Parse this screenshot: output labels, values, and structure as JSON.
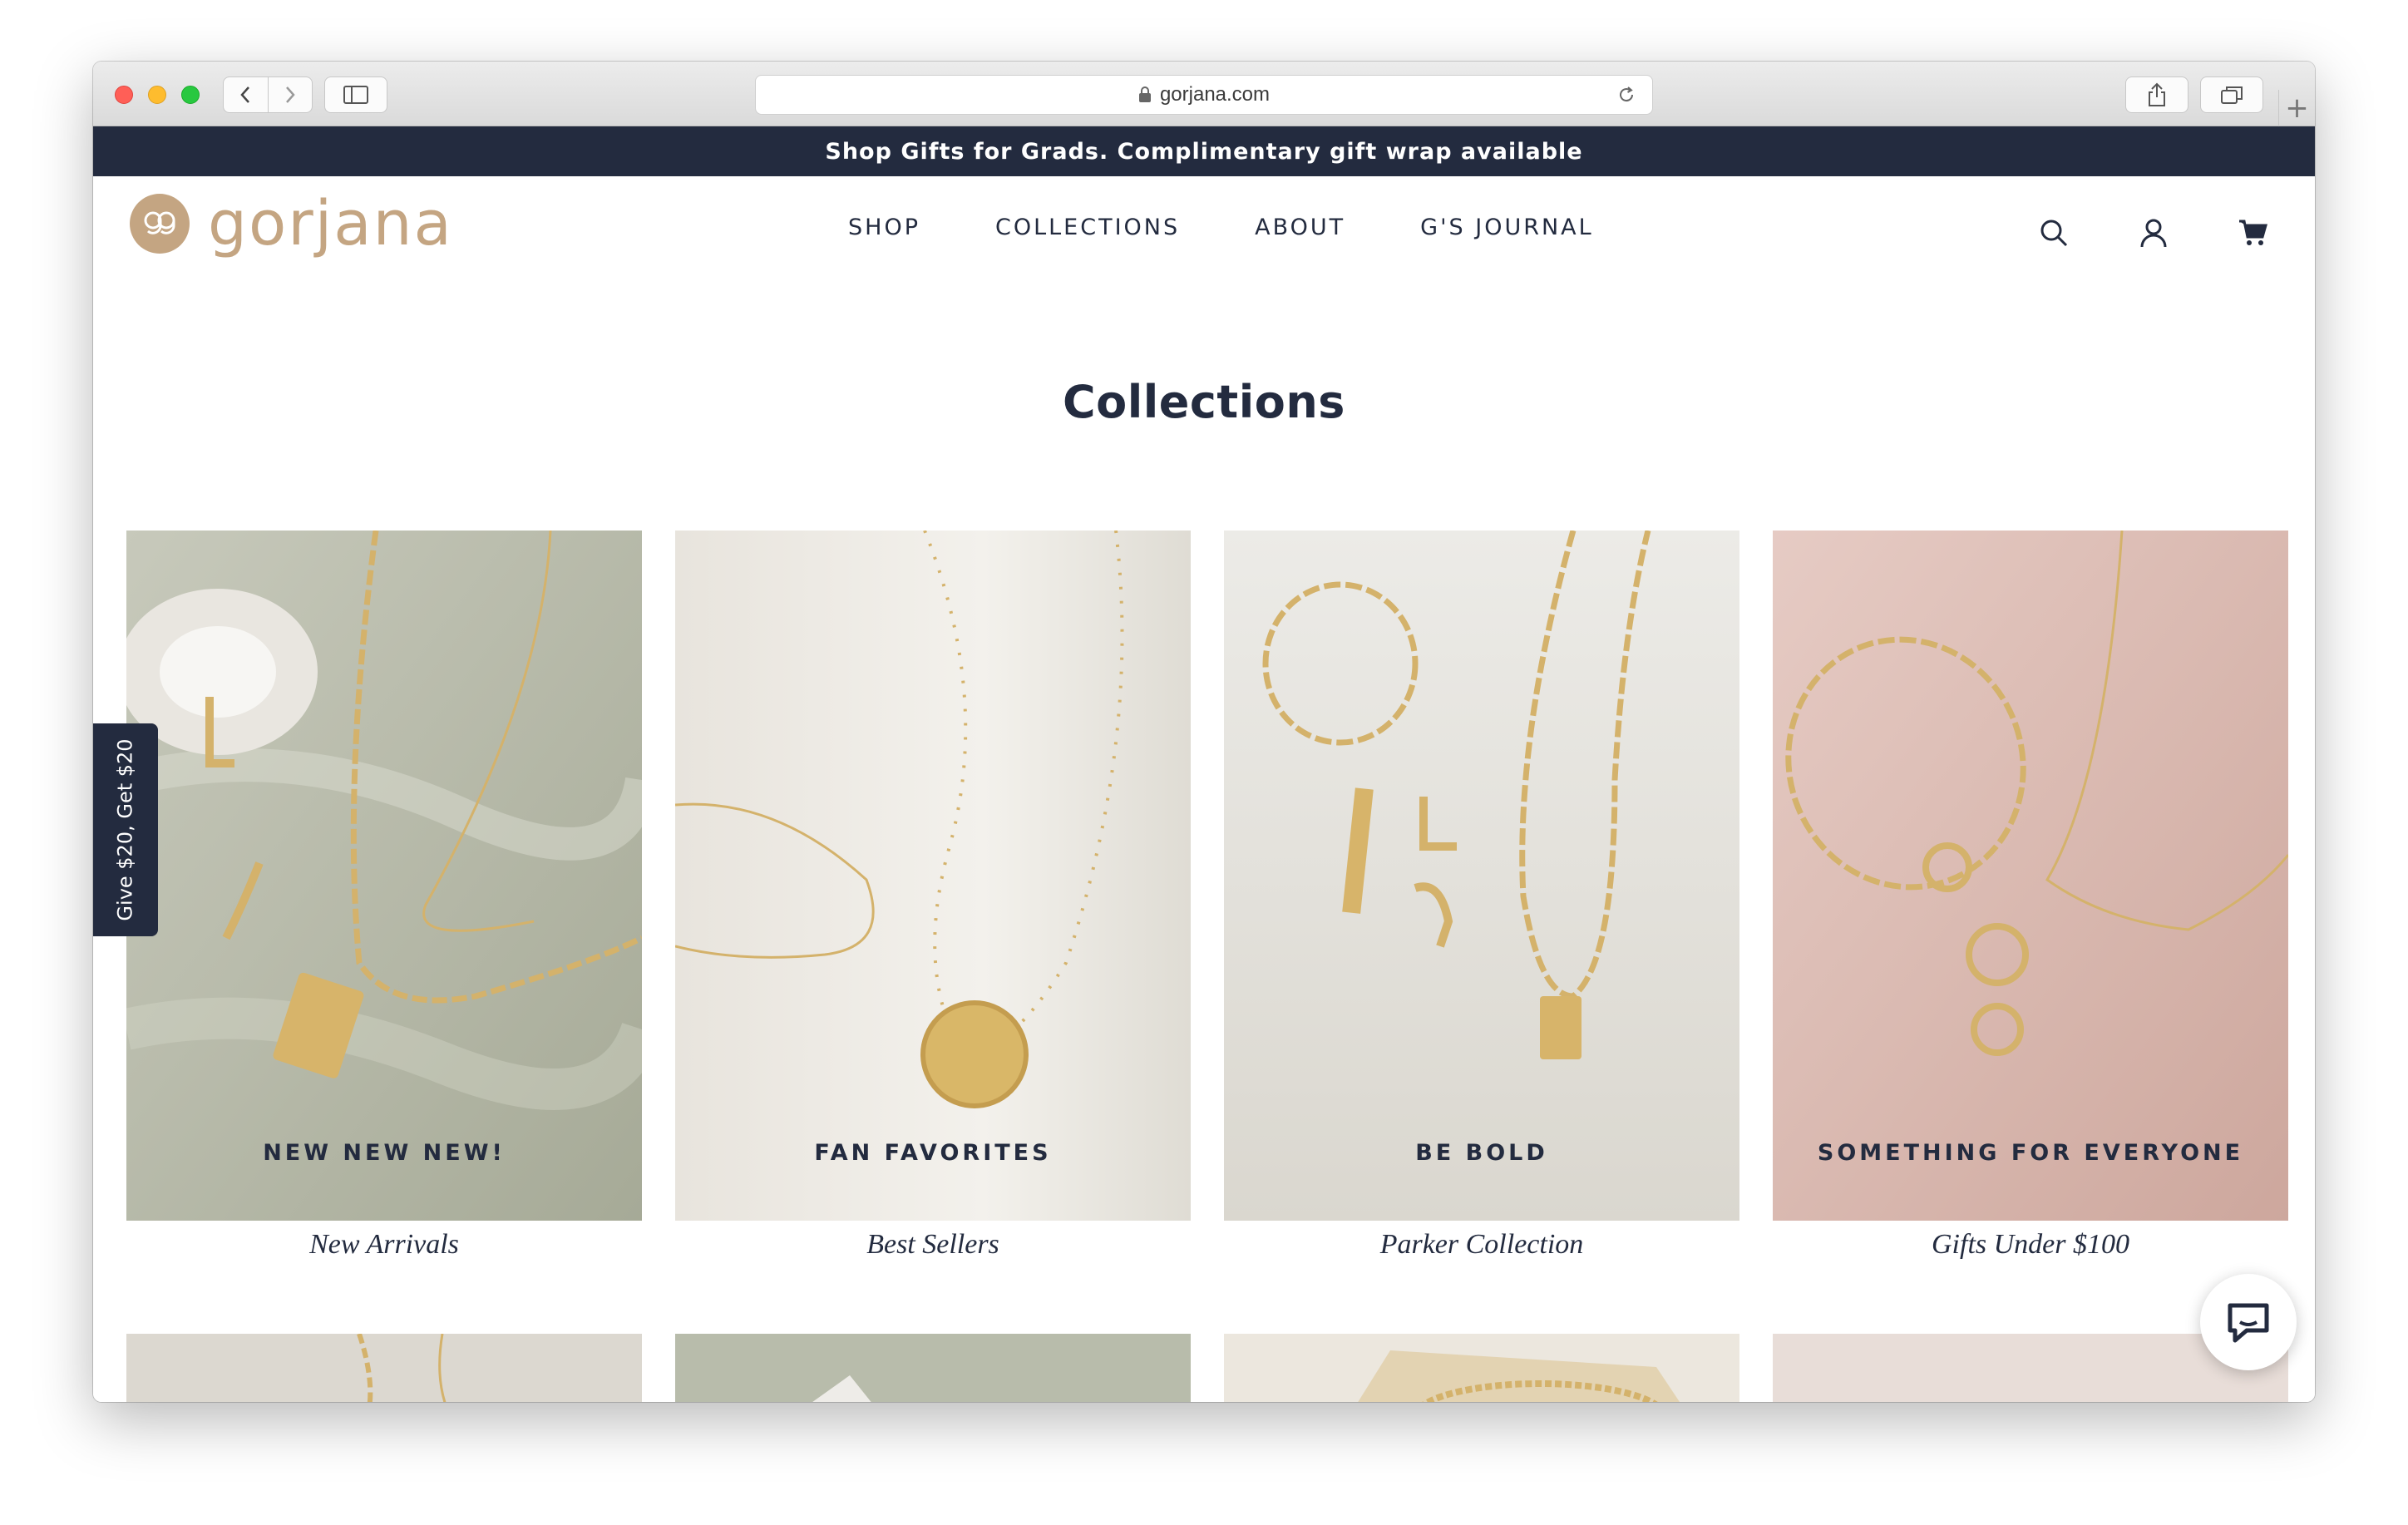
{
  "browser": {
    "url": "gorjana.com"
  },
  "promo_bar": {
    "text": "Shop Gifts for Grads. Complimentary gift wrap available"
  },
  "header": {
    "logo_text": "gorjana",
    "nav": [
      "SHOP",
      "COLLECTIONS",
      "ABOUT",
      "G'S JOURNAL"
    ]
  },
  "page": {
    "title": "Collections"
  },
  "collections": [
    {
      "label": "NEW NEW NEW!",
      "caption": "New Arrivals",
      "bg": "#b6b9a8"
    },
    {
      "label": "FAN FAVORITES",
      "caption": "Best Sellers",
      "bg": "#ece8e1"
    },
    {
      "label": "BE BOLD",
      "caption": "Parker Collection",
      "bg": "#e5e2dc"
    },
    {
      "label": "SOMETHING FOR EVERYONE",
      "caption": "Gifts Under $100",
      "bg": "#ddbfb7"
    }
  ],
  "referral_tab": {
    "text": "Give $20, Get $20"
  },
  "colors": {
    "navy": "#232b3f",
    "gold": "#c4a582"
  }
}
